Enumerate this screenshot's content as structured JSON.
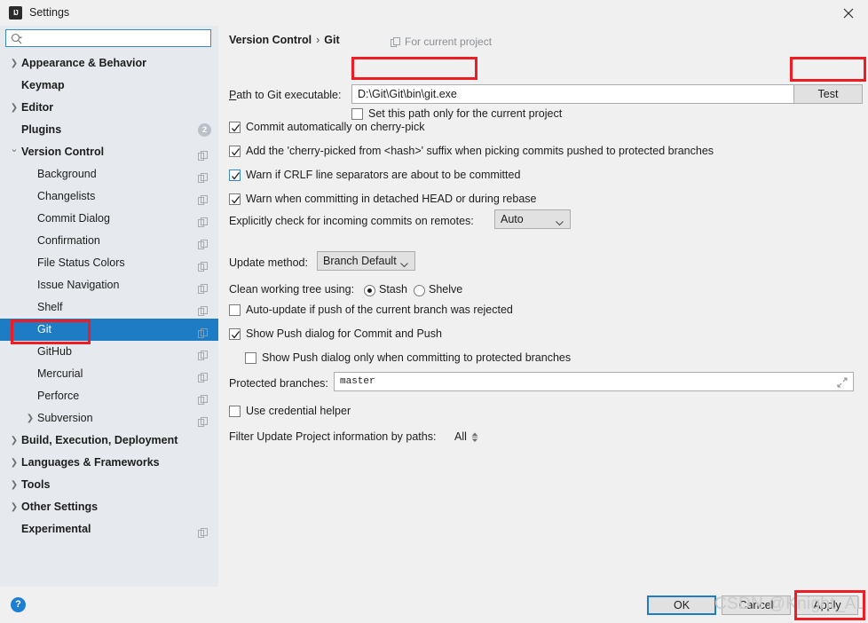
{
  "window": {
    "title": "Settings",
    "app_icon": "IJ",
    "close_icon": "close-icon"
  },
  "sidebar": {
    "search": {
      "value": "",
      "placeholder": "",
      "icon": "search-icon"
    },
    "items": [
      {
        "label": "Appearance & Behavior",
        "level": 0,
        "bold": true,
        "arrow": "›",
        "copy": false,
        "selected": false
      },
      {
        "label": "Keymap",
        "level": 0,
        "bold": true,
        "arrow": "",
        "copy": false,
        "selected": false
      },
      {
        "label": "Editor",
        "level": 0,
        "bold": true,
        "arrow": "›",
        "copy": false,
        "selected": false
      },
      {
        "label": "Plugins",
        "level": 0,
        "bold": true,
        "arrow": "",
        "copy": false,
        "selected": false,
        "badge": "2"
      },
      {
        "label": "Version Control",
        "level": 0,
        "bold": true,
        "arrow": "⌄",
        "copy": true,
        "selected": false
      },
      {
        "label": "Background",
        "level": 1,
        "bold": false,
        "arrow": "",
        "copy": true,
        "selected": false
      },
      {
        "label": "Changelists",
        "level": 1,
        "bold": false,
        "arrow": "",
        "copy": true,
        "selected": false
      },
      {
        "label": "Commit Dialog",
        "level": 1,
        "bold": false,
        "arrow": "",
        "copy": true,
        "selected": false
      },
      {
        "label": "Confirmation",
        "level": 1,
        "bold": false,
        "arrow": "",
        "copy": true,
        "selected": false
      },
      {
        "label": "File Status Colors",
        "level": 1,
        "bold": false,
        "arrow": "",
        "copy": true,
        "selected": false
      },
      {
        "label": "Issue Navigation",
        "level": 1,
        "bold": false,
        "arrow": "",
        "copy": true,
        "selected": false
      },
      {
        "label": "Shelf",
        "level": 1,
        "bold": false,
        "arrow": "",
        "copy": true,
        "selected": false
      },
      {
        "label": "Git",
        "level": 1,
        "bold": false,
        "arrow": "",
        "copy": true,
        "selected": true
      },
      {
        "label": "GitHub",
        "level": 1,
        "bold": false,
        "arrow": "",
        "copy": true,
        "selected": false
      },
      {
        "label": "Mercurial",
        "level": 1,
        "bold": false,
        "arrow": "",
        "copy": true,
        "selected": false
      },
      {
        "label": "Perforce",
        "level": 1,
        "bold": false,
        "arrow": "",
        "copy": true,
        "selected": false
      },
      {
        "label": "Subversion",
        "level": 1,
        "bold": false,
        "arrow": "›",
        "copy": true,
        "selected": false
      },
      {
        "label": "Build, Execution, Deployment",
        "level": 0,
        "bold": true,
        "arrow": "›",
        "copy": false,
        "selected": false
      },
      {
        "label": "Languages & Frameworks",
        "level": 0,
        "bold": true,
        "arrow": "›",
        "copy": false,
        "selected": false
      },
      {
        "label": "Tools",
        "level": 0,
        "bold": true,
        "arrow": "›",
        "copy": false,
        "selected": false
      },
      {
        "label": "Other Settings",
        "level": 0,
        "bold": true,
        "arrow": "›",
        "copy": false,
        "selected": false
      },
      {
        "label": "Experimental",
        "level": 0,
        "bold": true,
        "arrow": "",
        "copy": true,
        "selected": false
      }
    ]
  },
  "main": {
    "breadcrumb_root": "Version Control",
    "breadcrumb_sep": "›",
    "breadcrumb_leaf": "Git",
    "for_current_project": "For current project",
    "path_label": "Path to Git executable:",
    "path_value": "D:\\Git\\Git\\bin\\git.exe",
    "browse_icon": "folder-icon",
    "test_button": "Test",
    "set_path_only_label": "Set this path only for the current project",
    "set_path_only_checked": false,
    "checkboxes": [
      {
        "label": "Commit automatically on cherry-pick",
        "checked": true,
        "focus": false
      },
      {
        "label": "Add the 'cherry-picked from <hash>' suffix when picking commits pushed to protected branches",
        "checked": true,
        "focus": false
      },
      {
        "label": "Warn if CRLF line separators are about to be committed",
        "checked": true,
        "focus": true
      },
      {
        "label": "Warn when committing in detached HEAD or during rebase",
        "checked": true,
        "focus": false
      }
    ],
    "incoming_label": "Explicitly check for incoming commits on remotes:",
    "incoming_value": "Auto",
    "update_method_label": "Update method:",
    "update_method_value": "Branch Default",
    "clean_tree_label": "Clean working tree using:",
    "clean_stash": "Stash",
    "clean_shelve": "Shelve",
    "clean_selected": "Stash",
    "auto_update_label": "Auto-update if push of the current branch was rejected",
    "auto_update_checked": false,
    "show_push_label": "Show Push dialog for Commit and Push",
    "show_push_checked": true,
    "show_push_protected_label": "Show Push dialog only when committing to protected branches",
    "show_push_protected_checked": false,
    "protected_branches_label": "Protected branches:",
    "protected_branches_value": "master",
    "expand_icon": "expand-icon",
    "credential_helper_label": "Use credential helper",
    "credential_helper_checked": false,
    "filter_label": "Filter Update Project information by paths:",
    "filter_value": "All",
    "filter_stepper_icon": "stepper-icon"
  },
  "footer": {
    "help_icon": "?",
    "ok": "OK",
    "cancel": "Cancel",
    "apply": "Apply"
  },
  "watermark": {
    "text": "CSDN @Knight_AL"
  },
  "annotations": {
    "color": "#ee1d24",
    "boxes": [
      "path-field",
      "test-button",
      "git-sidebar-item",
      "apply-button"
    ]
  }
}
